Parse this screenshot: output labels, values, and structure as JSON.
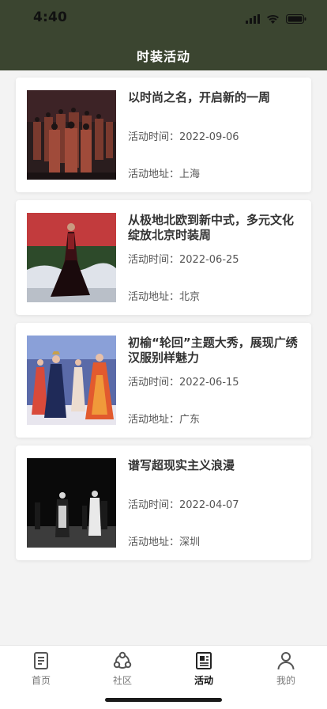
{
  "status": {
    "time": "4:40"
  },
  "header": {
    "title": "时装活动"
  },
  "events": [
    {
      "title": "以时尚之名，开启新的一周",
      "time_label": "活动时间：",
      "time": "2022-09-06",
      "addr_label": "活动地址：",
      "address": "上海"
    },
    {
      "title": "从极地北欧到新中式，多元文化绽放北京时装周",
      "time_label": "活动时间：",
      "time": "2022-06-25",
      "addr_label": "活动地址：",
      "address": "北京"
    },
    {
      "title": "初榆“轮回”主题大秀，展现广绣汉服别样魅力",
      "time_label": "活动时间：",
      "time": "2022-06-15",
      "addr_label": "活动地址：",
      "address": "广东"
    },
    {
      "title": "谱写超现实主义浪漫",
      "time_label": "活动时间：",
      "time": "2022-04-07",
      "addr_label": "活动地址：",
      "address": "深圳"
    }
  ],
  "tabbar": {
    "items": [
      {
        "label": "首页",
        "icon": "document-icon",
        "active": false
      },
      {
        "label": "社区",
        "icon": "community-icon",
        "active": false
      },
      {
        "label": "活动",
        "icon": "newspaper-icon",
        "active": true
      },
      {
        "label": "我的",
        "icon": "person-icon",
        "active": false
      }
    ]
  },
  "colors": {
    "header_bg": "#3b4530",
    "page_bg": "#f3f3f3",
    "card_bg": "#ffffff"
  }
}
